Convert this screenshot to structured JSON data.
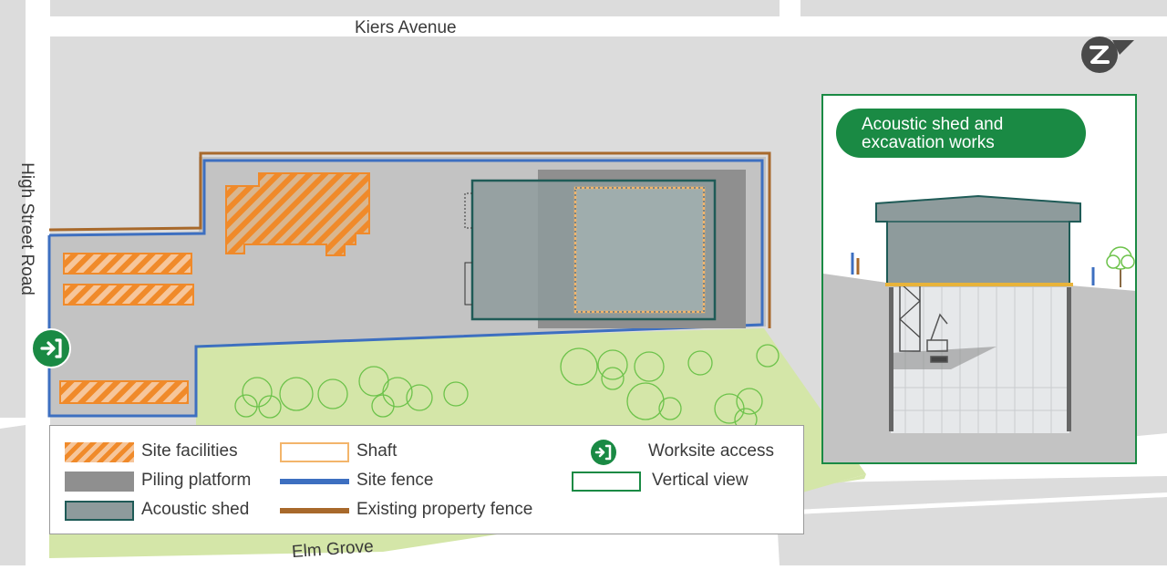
{
  "streets": {
    "north": "Kiers Avenue",
    "west": "High Street Road",
    "south": "Elm Grove"
  },
  "icons": {
    "compass": "north-arrow-icon",
    "access": "arrow-right-enter-icon"
  },
  "inset": {
    "title": "Acoustic shed and\nexcavation works"
  },
  "legend": {
    "items": [
      {
        "label": "Site facilities",
        "swatch": "orange-hatch"
      },
      {
        "label": "Piling platform",
        "swatch": "dark-grey"
      },
      {
        "label": "Acoustic shed",
        "swatch": "grey-green-outlined"
      },
      {
        "label": "Shaft",
        "swatch": "orange-outline"
      },
      {
        "label": "Site fence",
        "swatch": "blue-line"
      },
      {
        "label": "Existing property fence",
        "swatch": "brown-line"
      },
      {
        "label": "Worksite access",
        "swatch": "green-access-icon"
      },
      {
        "label": "Vertical view",
        "swatch": "green-outline"
      }
    ]
  },
  "colors": {
    "site_facilities": "#f08a2a",
    "piling_platform": "#8f8f8f",
    "acoustic_shed": "#8e9b9c",
    "shed_outline": "#1f5b57",
    "shaft": "#f3b56b",
    "site_fence": "#3d6fc0",
    "property_fence": "#a8692b",
    "accent_green": "#1a8a44",
    "park": "#d4e6a8",
    "road_block": "#dcdcdc",
    "worksite": "#c3c3c3"
  }
}
